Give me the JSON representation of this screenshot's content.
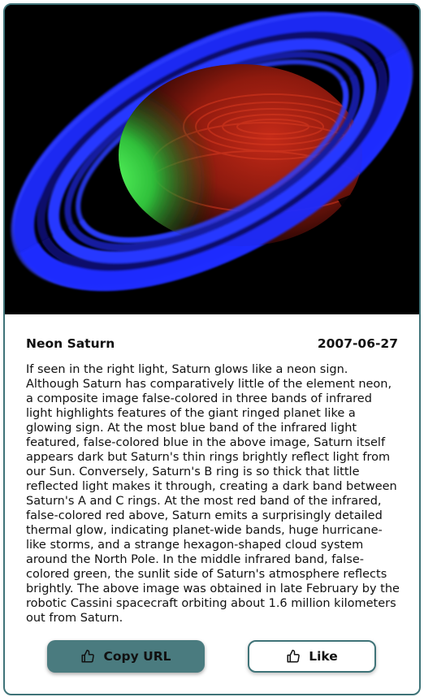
{
  "post": {
    "image_alt": "Neon Saturn",
    "title": "Neon Saturn",
    "date": "2007-06-27",
    "description": "If seen in the right light, Saturn glows like a neon sign. Although Saturn has comparatively little of the element neon, a composite image false-colored in three bands of infrared light highlights features of the giant ringed planet like a glowing sign. At the most blue band of the infrared light featured, false-colored blue in the above image, Saturn itself appears dark but Saturn's thin rings brightly reflect light from our Sun. Conversely, Saturn's B ring is so thick that little reflected light makes it through, creating a dark band between Saturn's A and C rings. At the most red band of the infrared, false-colored red above, Saturn emits a surprisingly detailed thermal glow, indicating planet-wide bands, huge hurricane-like storms, and a strange hexagon-shaped cloud system around the North Pole. In the middle infrared band, false-colored green, the sunlit side of Saturn's atmosphere reflects brightly. The above image was obtained in late February by the robotic Cassini spacecraft orbiting about 1.6 million kilometers out from Saturn."
  },
  "actions": {
    "copy_url_label": "Copy URL",
    "copy_url_icon": "thumbs-up-icon",
    "like_label": "Like",
    "like_icon": "thumbs-up-icon"
  },
  "colors": {
    "accent": "#4a7b7f",
    "border": "#3f7378",
    "text": "#111111",
    "image_background": "#000000"
  }
}
